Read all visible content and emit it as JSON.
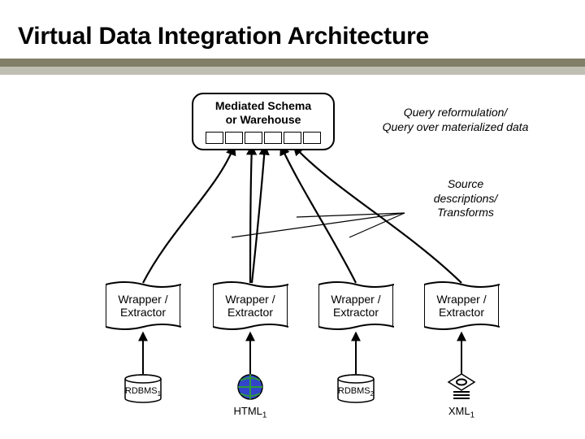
{
  "title": "Virtual Data Integration Architecture",
  "schema": {
    "line1": "Mediated Schema",
    "line2": "or Warehouse"
  },
  "notes": {
    "query_reformulation": {
      "line1": "Query reformulation/",
      "line2": "Query over materialized data"
    },
    "source_descriptions": {
      "line1": "Source",
      "line2": "descriptions/",
      "line3": "Transforms"
    }
  },
  "wrappers": {
    "label_l1": "Wrapper /",
    "label_l2": "Extractor"
  },
  "sources": {
    "rdbms1": {
      "base": "RDBMS",
      "sub": "1"
    },
    "html1": {
      "base": "HTML",
      "sub": "1"
    },
    "rdbms2": {
      "base": "RDBMS",
      "sub": "2"
    },
    "xml1": {
      "base": "XML",
      "sub": "1"
    }
  }
}
